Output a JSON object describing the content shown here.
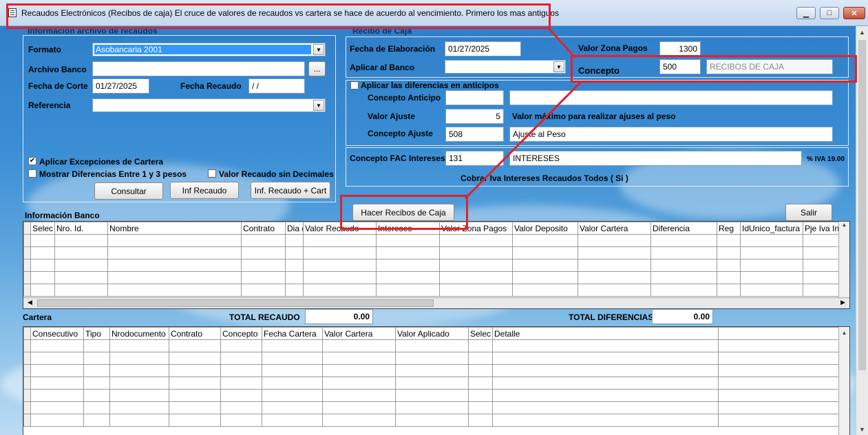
{
  "window": {
    "title": "Recaudos Electrónicos (Recibos de caja) El  cruce de valores de recaudos vs cartera se hace de acuerdo al vencimiento. Primero los mas antiguos",
    "icon": "form-icon",
    "minimize": "▁",
    "maximize": "□",
    "close": "✕"
  },
  "info_archivo": {
    "legend": "Información archivo de recaudos",
    "formato_label": "Formato",
    "formato_value": "Asobancaria 2001",
    "archivo_label": "Archivo Banco",
    "archivo_value": "",
    "browse_label": "...",
    "fecha_corte_label": "Fecha de Corte",
    "fecha_corte_value": "01/27/2025",
    "fecha_recaudo_label": "Fecha Recaudo",
    "fecha_recaudo_value": " / /",
    "referencia_label": "Referencia",
    "referencia_value": "",
    "aplicar_excepciones_label": "Aplicar Excepciones de Cartera",
    "aplicar_excepciones_checked": "✔",
    "mostrar_diferencias_label": "Mostrar Diferencias Entre 1 y 3 pesos",
    "valor_sin_decimales_label": "Valor Recaudo sin Decimales",
    "consultar_label": "Consultar",
    "inf_recaudo_label": "Inf Recaudo",
    "inf_recaudo_cart_label": "Inf. Recaudo + Cart"
  },
  "recibo": {
    "legend": "Recibo de Caja",
    "fecha_elab_label": "Fecha de Elaboración",
    "fecha_elab_value": "01/27/2025",
    "aplicar_banco_label": "Aplicar al Banco",
    "aplicar_banco_value": "",
    "valor_zona_label": "Valor Zona Pagos",
    "valor_zona_value": "1300",
    "concepto_label": "Concepto",
    "concepto_code": "500",
    "concepto_desc": "RECIBOS DE CAJA",
    "aplicar_dif_label": "Aplicar las diferencias en anticipos",
    "concepto_anticipo_label": "Concepto Anticipo",
    "concepto_anticipo_code": "",
    "concepto_anticipo_desc": "",
    "valor_ajuste_label": "Valor Ajuste",
    "valor_ajuste_value": "5",
    "valor_maximo_note": "Valor máximo para realizar ajuses al peso",
    "concepto_ajuste_label": "Concepto Ajuste",
    "concepto_ajuste_code": "508",
    "concepto_ajuste_desc": "Ajuste al Peso",
    "concepto_fac_label": "Concepto FAC Intereses",
    "concepto_fac_code": "131",
    "concepto_fac_desc": "INTERESES",
    "iva_label": "% IVA 19.00",
    "cobrar_iva_label": "Cobrar Iva Intereses Recaudos Todos ( Si )"
  },
  "actions": {
    "hacer_recibos_label": "Hacer Recibos de Caja",
    "salir_label": "Salir"
  },
  "banco_grid": {
    "title": "Información Banco",
    "columns": [
      "Selec",
      "Nro. Id.",
      "Nombre",
      "Contrato",
      "Dia (",
      "Valor Recaudo",
      "Intereses",
      "Valor Zona Pagos",
      "Valor Deposito",
      "Valor Cartera",
      "Diferencia",
      "Reg",
      "IdUnico_factura",
      "Pje Iva Int"
    ],
    "left_arrow": "◀",
    "right_arrow": "▶",
    "up_arrow": "▲"
  },
  "cartera": {
    "title": "Cartera",
    "total_recaudo_label": "TOTAL RECAUDO",
    "total_recaudo_value": "0.00",
    "total_diferencias_label": "TOTAL DIFERENCIAS",
    "total_diferencias_value": "0.00",
    "columns": [
      "Consecutivo",
      "Tipo",
      "Nrodocumento",
      "Contrato",
      "Concepto",
      "Fecha Cartera",
      "Valor Cartera",
      "Valor Aplicado",
      "Selec",
      "Detalle",
      ""
    ],
    "up_arrow": "▲"
  },
  "scrollbar": {
    "up": "▲",
    "down": "▼"
  },
  "colors": {
    "highlight": "#e3212b",
    "accent": "#3399ff"
  }
}
